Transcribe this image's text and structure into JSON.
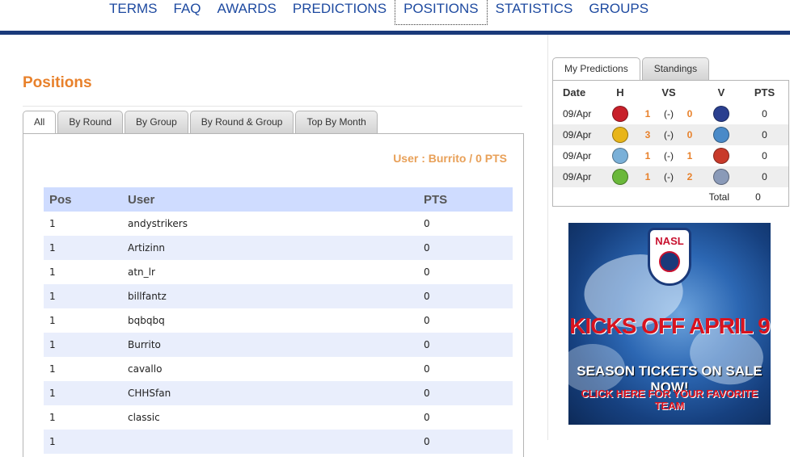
{
  "nav": {
    "items": [
      "TERMS",
      "FAQ",
      "AWARDS",
      "PREDICTIONS",
      "POSITIONS",
      "STATISTICS",
      "GROUPS"
    ],
    "active": "POSITIONS"
  },
  "page": {
    "title": "Positions",
    "tabs": [
      "All",
      "By Round",
      "By Group",
      "By Round & Group",
      "Top By Month"
    ],
    "active_tab": "All",
    "user_line": "User : Burrito / 0 PTS"
  },
  "positions_table": {
    "headers": {
      "pos": "Pos",
      "user": "User",
      "pts": "PTS"
    },
    "rows": [
      {
        "pos": "1",
        "user": "andystrikers",
        "pts": "0"
      },
      {
        "pos": "1",
        "user": "Artizinn",
        "pts": "0"
      },
      {
        "pos": "1",
        "user": "atn_lr",
        "pts": "0"
      },
      {
        "pos": "1",
        "user": "billfantz",
        "pts": "0"
      },
      {
        "pos": "1",
        "user": "bqbqbq",
        "pts": "0"
      },
      {
        "pos": "1",
        "user": "Burrito",
        "pts": "0"
      },
      {
        "pos": "1",
        "user": "cavallo",
        "pts": "0"
      },
      {
        "pos": "1",
        "user": "CHHSfan",
        "pts": "0"
      },
      {
        "pos": "1",
        "user": "classic",
        "pts": "0"
      },
      {
        "pos": "1",
        "user": "",
        "pts": "0"
      }
    ]
  },
  "predictions": {
    "tabs": [
      "My Predictions",
      "Standings"
    ],
    "active_tab": "My Predictions",
    "headers": {
      "date": "Date",
      "home": "H",
      "vs": "VS",
      "visitor": "V",
      "pts": "PTS"
    },
    "rows": [
      {
        "date": "09/Apr",
        "home_score": "1",
        "separator": "(-)",
        "visitor_score": "0",
        "pts": "0",
        "home_color": "#c8202a",
        "visitor_color": "#2a3f8f"
      },
      {
        "date": "09/Apr",
        "home_score": "3",
        "separator": "(-)",
        "visitor_score": "0",
        "pts": "0",
        "home_color": "#e8b51a",
        "visitor_color": "#4a8ac8"
      },
      {
        "date": "09/Apr",
        "home_score": "1",
        "separator": "(-)",
        "visitor_score": "1",
        "pts": "0",
        "home_color": "#7ab0d8",
        "visitor_color": "#c83a2a"
      },
      {
        "date": "09/Apr",
        "home_score": "1",
        "separator": "(-)",
        "visitor_score": "2",
        "pts": "0",
        "home_color": "#6ab83a",
        "visitor_color": "#8a9ab8"
      }
    ],
    "total_label": "Total",
    "total_value": "0"
  },
  "ad": {
    "logo_text": "NASL",
    "line1": "KICKS OFF APRIL 9",
    "line2": "SEASON TICKETS ON SALE NOW!",
    "line3": "CLICK HERE FOR YOUR FAVORITE TEAM"
  },
  "colors": {
    "accent": "#e8812b",
    "nav_link": "#1e4aa0",
    "nav_bar": "#1a3a7a",
    "table_header": "#cfdcff",
    "table_alt_row": "#e9eefc"
  }
}
